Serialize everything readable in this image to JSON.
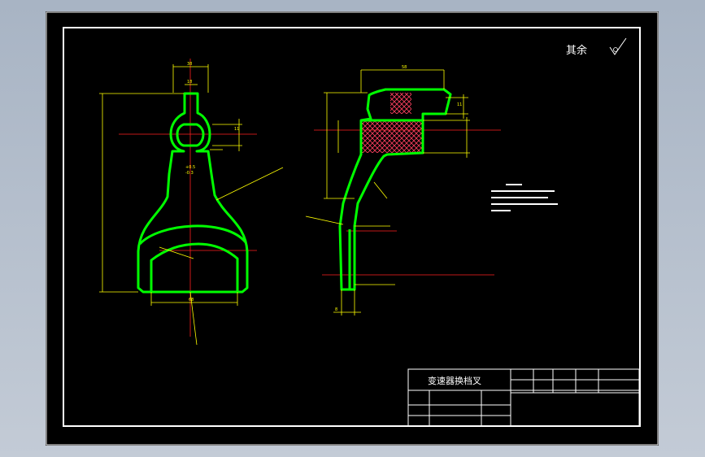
{
  "colors": {
    "background": "#000000",
    "outline": "#00ff00",
    "dimension": "#ffff00",
    "centerline": "#ff2020",
    "frame": "#ffffff",
    "hatch_fill": "#ff4060"
  },
  "roughness_note": "其余",
  "title_block": {
    "part_name": "变速器换档叉"
  },
  "dimensions": {
    "top_width": "38",
    "slot_width": "18",
    "hole_height": "11",
    "tol_upper": "+0.5",
    "tol_lower": "-0.3",
    "bottom_width": "68",
    "side_top_width": "58",
    "right_height": "11",
    "bar_height": "8",
    "thickness": "8"
  }
}
